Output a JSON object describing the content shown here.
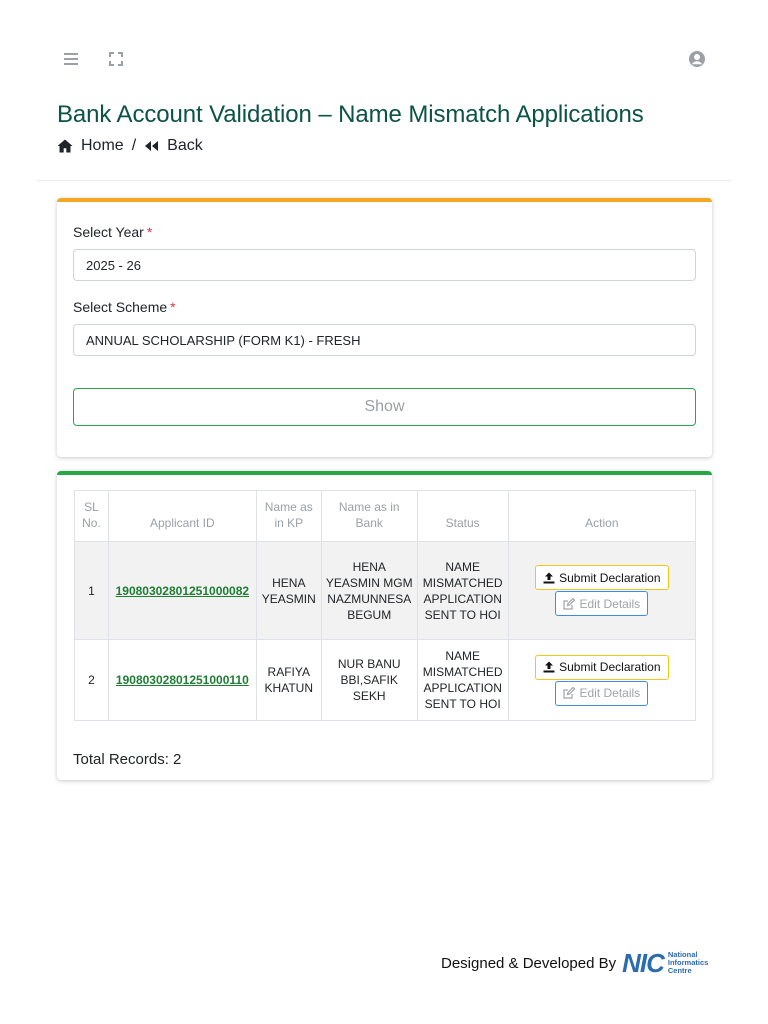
{
  "topbar": {
    "menu_icon": "hamburger-icon",
    "expand_icon": "fullscreen-icon",
    "user_icon": "user-circle-icon"
  },
  "page": {
    "title": "Bank Account Validation – Name Mismatch Applications",
    "breadcrumb": {
      "home": "Home",
      "separator": "/",
      "back": "Back"
    }
  },
  "form": {
    "year_label": "Select Year",
    "year_value": "2025 - 26",
    "scheme_label": "Select Scheme",
    "scheme_value": "ANNUAL SCHOLARSHIP (FORM K1) - FRESH",
    "required_mark": "*",
    "show_label": "Show"
  },
  "table": {
    "headers": {
      "sl": "SL No.",
      "applicant_id": "Applicant ID",
      "name_kp": "Name as in KP",
      "name_bank": "Name as in Bank",
      "status": "Status",
      "action": "Action"
    },
    "rows": [
      {
        "sl": "1",
        "applicant_id": "19080302801251000082",
        "name_kp": "HENA YEASMIN",
        "name_bank": "HENA YEASMIN MGM NAZMUNNESA BEGUM",
        "status": "NAME MISMATCHED APPLICATION SENT TO HOI",
        "submit_label": "Submit Declaration",
        "edit_label": "Edit Details"
      },
      {
        "sl": "2",
        "applicant_id": "19080302801251000110",
        "name_kp": "RAFIYA KHATUN",
        "name_bank": "NUR BANU BBI,SAFIK SEKH",
        "status": "NAME MISMATCHED APPLICATION SENT TO HOI",
        "submit_label": "Submit Declaration",
        "edit_label": "Edit Details"
      }
    ],
    "total": "Total Records: 2"
  },
  "footer": {
    "text": "Designed & Developed By",
    "logo_mark": "NIC",
    "logo_line1": "National",
    "logo_line2": "Informatics",
    "logo_line3": "Centre"
  },
  "colors": {
    "title": "#0b5345",
    "form_card_accent": "#f5a623",
    "table_card_accent": "#28a745",
    "link": "#1e7e34",
    "nic_blue": "#2b6cb0"
  }
}
